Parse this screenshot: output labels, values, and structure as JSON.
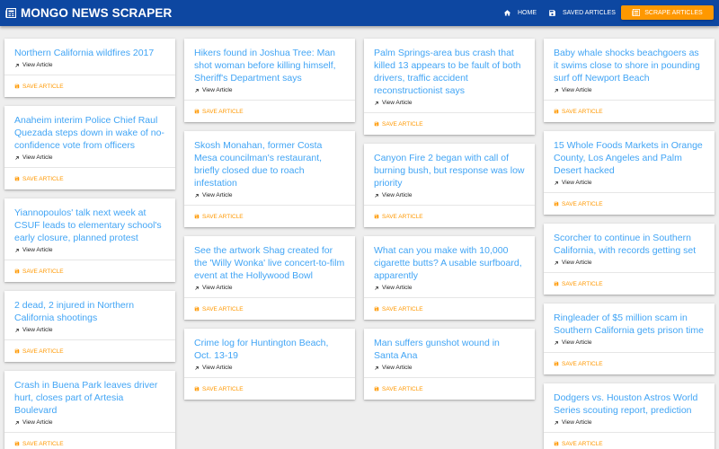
{
  "nav": {
    "brand": "MONGO NEWS SCRAPER",
    "home_label": "HOME",
    "saved_label": "SAVED ARTICLES",
    "scrape_label": "SCRAPE ARTICLES"
  },
  "labels": {
    "view": "View Article",
    "save": "SAVE ARTICLE"
  },
  "colors": {
    "navbar": "#0d47a1",
    "accent": "#ff9800",
    "title": "#42a5f5",
    "background": "#eeeeee"
  },
  "icons": {
    "brand": "newspaper-icon",
    "home": "home-icon",
    "saved": "save-icon",
    "scrape": "news-icon",
    "view": "arrow-up-right-icon",
    "save": "save-icon"
  },
  "columns": [
    [
      {
        "title": "Northern California wildfires 2017"
      },
      {
        "title": "Anaheim interim Police Chief Raul Quezada steps down in wake of no-confidence vote from officers"
      },
      {
        "title": "Yiannopoulos' talk next week at CSUF leads to elementary school's early closure, planned protest"
      },
      {
        "title": "2 dead, 2 injured in Northern California shootings"
      },
      {
        "title": "Crash in Buena Park leaves driver hurt, closes part of Artesia Boulevard"
      }
    ],
    [
      {
        "title": "Hikers found in Joshua Tree: Man shot woman before killing himself, Sheriff's Department says"
      },
      {
        "title": "Skosh Monahan, former Costa Mesa councilman's restaurant, briefly closed due to roach infestation"
      },
      {
        "title": "See the artwork Shag created for the 'Willy Wonka' live concert-to-film event at the Hollywood Bowl"
      },
      {
        "title": "Crime log for Huntington Beach, Oct. 13-19"
      }
    ],
    [
      {
        "title": "Palm Springs-area bus crash that killed 13 appears to be fault of both drivers, traffic accident reconstructionist says"
      },
      {
        "title": "Canyon Fire 2 began with call of burning bush, but response was low priority"
      },
      {
        "title": "What can you make with 10,000 cigarette butts? A usable surfboard, apparently"
      },
      {
        "title": "Man suffers gunshot wound in Santa Ana"
      }
    ],
    [
      {
        "title": "Baby whale shocks beachgoers as it swims close to shore in pounding surf off Newport Beach"
      },
      {
        "title": "15 Whole Foods Markets in Orange County, Los Angeles and Palm Desert hacked"
      },
      {
        "title": "Scorcher to continue in Southern California, with records getting set"
      },
      {
        "title": "Ringleader of $5 million scam in Southern California gets prison time"
      },
      {
        "title": "Dodgers vs. Houston Astros World Series scouting report, prediction"
      }
    ]
  ]
}
